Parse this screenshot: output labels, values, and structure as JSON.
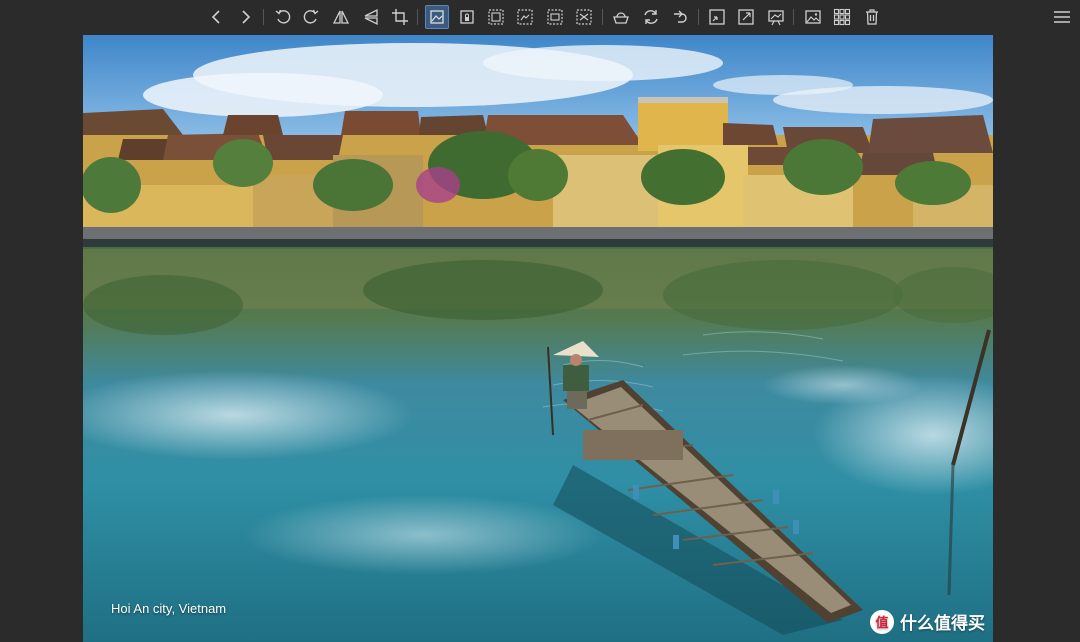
{
  "toolbar": {
    "buttons": [
      {
        "name": "prev-icon"
      },
      {
        "name": "next-icon"
      },
      {
        "name": "rotate-left-icon"
      },
      {
        "name": "rotate-right-icon"
      },
      {
        "name": "flip-horizontal-icon"
      },
      {
        "name": "flip-vertical-icon"
      },
      {
        "name": "crop-icon"
      },
      {
        "name": "image-fit-icon",
        "active": true
      },
      {
        "name": "image-lock-icon"
      },
      {
        "name": "image-frame-1-icon"
      },
      {
        "name": "image-frame-2-icon"
      },
      {
        "name": "image-frame-3-icon"
      },
      {
        "name": "image-frame-4-icon"
      },
      {
        "name": "basket-icon"
      },
      {
        "name": "refresh-icon"
      },
      {
        "name": "redo-icon"
      },
      {
        "name": "resize-shrink-icon"
      },
      {
        "name": "resize-expand-icon"
      },
      {
        "name": "slideshow-icon"
      },
      {
        "name": "image-icon"
      },
      {
        "name": "grid-icon"
      },
      {
        "name": "trash-icon"
      }
    ],
    "menu_icon": "hamburger-menu-icon"
  },
  "photo": {
    "caption": "Hoi An city, Vietnam",
    "watermark_text": "什么值得买",
    "watermark_logo": "值"
  },
  "colors": {
    "background": "#2b2b2b",
    "icon": "#cfcfcf",
    "active": "#3b5a80"
  }
}
